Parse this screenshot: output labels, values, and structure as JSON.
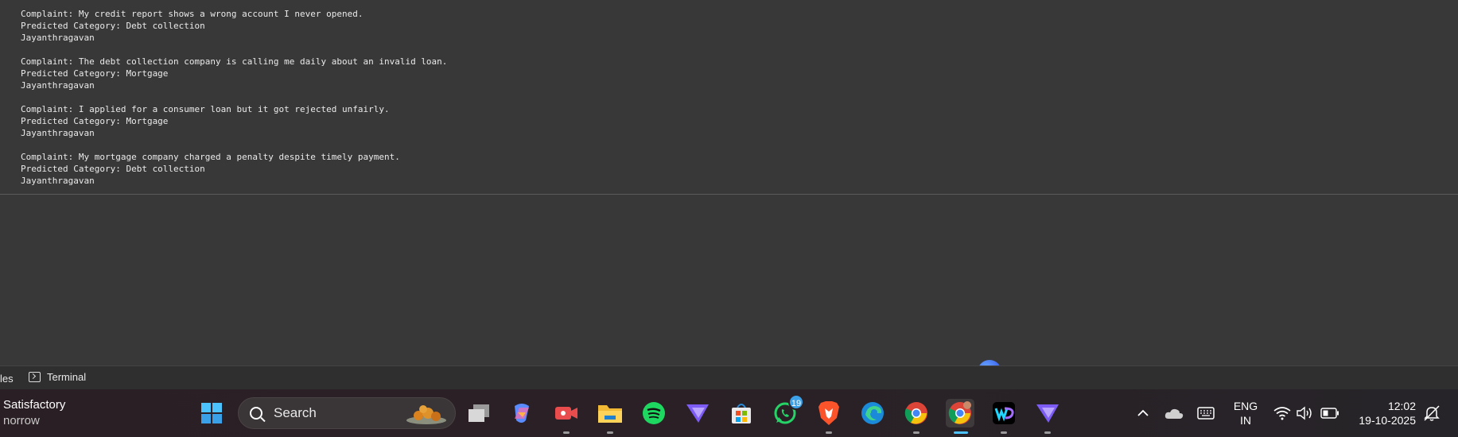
{
  "output": {
    "blocks": [
      {
        "complaint": "Complaint: My credit report shows a wrong account I never opened.",
        "prediction": "Predicted Category: Debt collection",
        "author": "Jayanthragavan"
      },
      {
        "complaint": "Complaint: The debt collection company is calling me daily about an invalid loan.",
        "prediction": "Predicted Category: Mortgage",
        "author": "Jayanthragavan"
      },
      {
        "complaint": "Complaint: I applied for a consumer loan but it got rejected unfairly.",
        "prediction": "Predicted Category: Mortgage",
        "author": "Jayanthragavan"
      },
      {
        "complaint": "Complaint: My mortgage company charged a penalty despite timely payment.",
        "prediction": "Predicted Category: Debt collection",
        "author": "Jayanthragavan"
      }
    ]
  },
  "statusbar": {
    "files_label": "les",
    "terminal_label": "Terminal"
  },
  "taskbar": {
    "weather": {
      "condition": "Satisfactory",
      "sub": "norrow"
    },
    "search_label": "Search",
    "whatsapp_badge": "19",
    "language": {
      "line1": "ENG",
      "line2": "IN"
    },
    "clock": {
      "time": "12:02",
      "date": "19-10-2025"
    },
    "icons": [
      "start-icon",
      "search-icon",
      "task-view-icon",
      "copilot-icon",
      "camera-app-icon",
      "file-explorer-icon",
      "spotify-icon",
      "proton-vpn-icon",
      "microsoft-store-icon",
      "whatsapp-icon",
      "brave-icon",
      "edge-icon",
      "chrome-icon",
      "chrome-profile-icon",
      "webstorm-icon",
      "proton-vpn-icon",
      "chevron-up-icon",
      "onedrive-icon",
      "keyboard-icon",
      "wifi-icon",
      "volume-icon",
      "battery-icon",
      "notification-icon"
    ]
  }
}
